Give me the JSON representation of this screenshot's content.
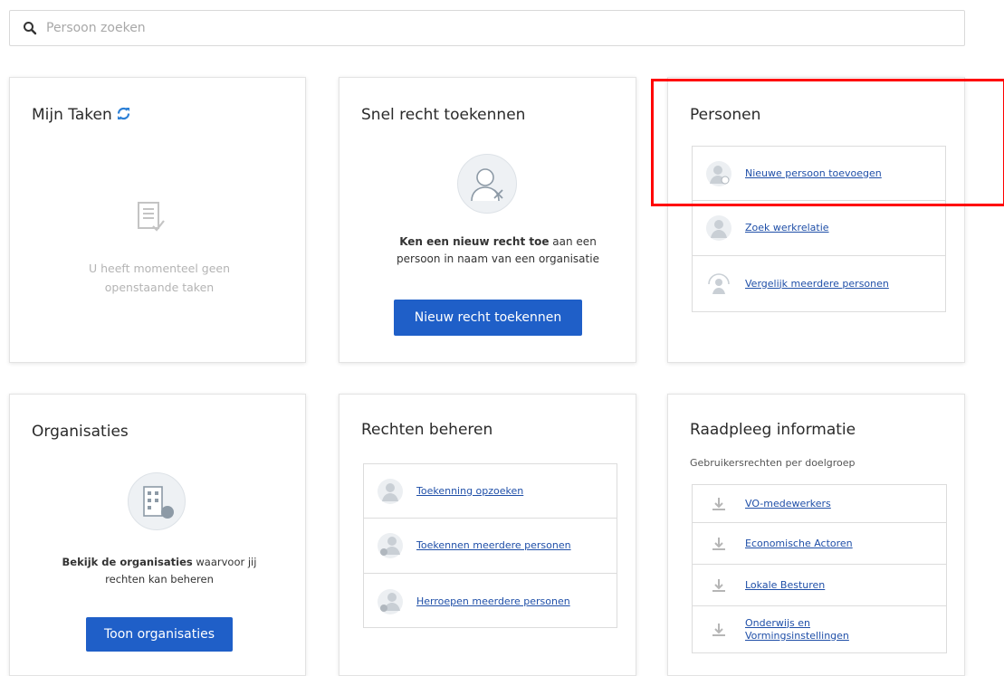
{
  "search": {
    "placeholder": "Persoon zoeken"
  },
  "tasks": {
    "title": "Mijn Taken",
    "empty_line1": "U heeft momenteel geen",
    "empty_line2": "openstaande taken"
  },
  "snel": {
    "title": "Snel recht toekennen",
    "text_bold": "Ken een nieuw recht toe",
    "text_rest1": " aan een",
    "text_line2": "persoon in naam van een organisatie",
    "button": "Nieuw recht toekennen"
  },
  "personen": {
    "title": "Personen",
    "links": [
      {
        "label": "Nieuwe persoon toevoegen",
        "icon": "add-person-icon"
      },
      {
        "label": "Zoek werkrelatie",
        "icon": "person-icon"
      },
      {
        "label": "Vergelijk meerdere personen",
        "icon": "compare-persons-icon"
      }
    ]
  },
  "organisaties": {
    "title": "Organisaties",
    "text_bold": "Bekijk de organisaties",
    "text_rest1": " waarvoor jij",
    "text_line2": "rechten kan beheren",
    "button": "Toon organisaties"
  },
  "rechten": {
    "title": "Rechten beheren",
    "links": [
      {
        "label": "Toekenning opzoeken",
        "icon": "person-search-icon"
      },
      {
        "label": "Toekennen meerdere personen",
        "icon": "persons-add-icon"
      },
      {
        "label": "Herroepen meerdere personen",
        "icon": "persons-revoke-icon"
      }
    ]
  },
  "raadpleeg": {
    "title": "Raadpleeg informatie",
    "subtitle": "Gebruikersrechten per doelgroep",
    "links": [
      {
        "label": "VO-medewerkers",
        "icon": "download-icon"
      },
      {
        "label": "Economische Actoren",
        "icon": "download-icon"
      },
      {
        "label": "Lokale Besturen",
        "icon": "download-icon"
      },
      {
        "label_line1": "Onderwijs en",
        "label_line2": "Vormingsinstellingen",
        "icon": "download-icon"
      }
    ]
  },
  "colors": {
    "accent": "#1f5fc8",
    "link": "#1f4fa8",
    "highlight": "#ff0000"
  }
}
